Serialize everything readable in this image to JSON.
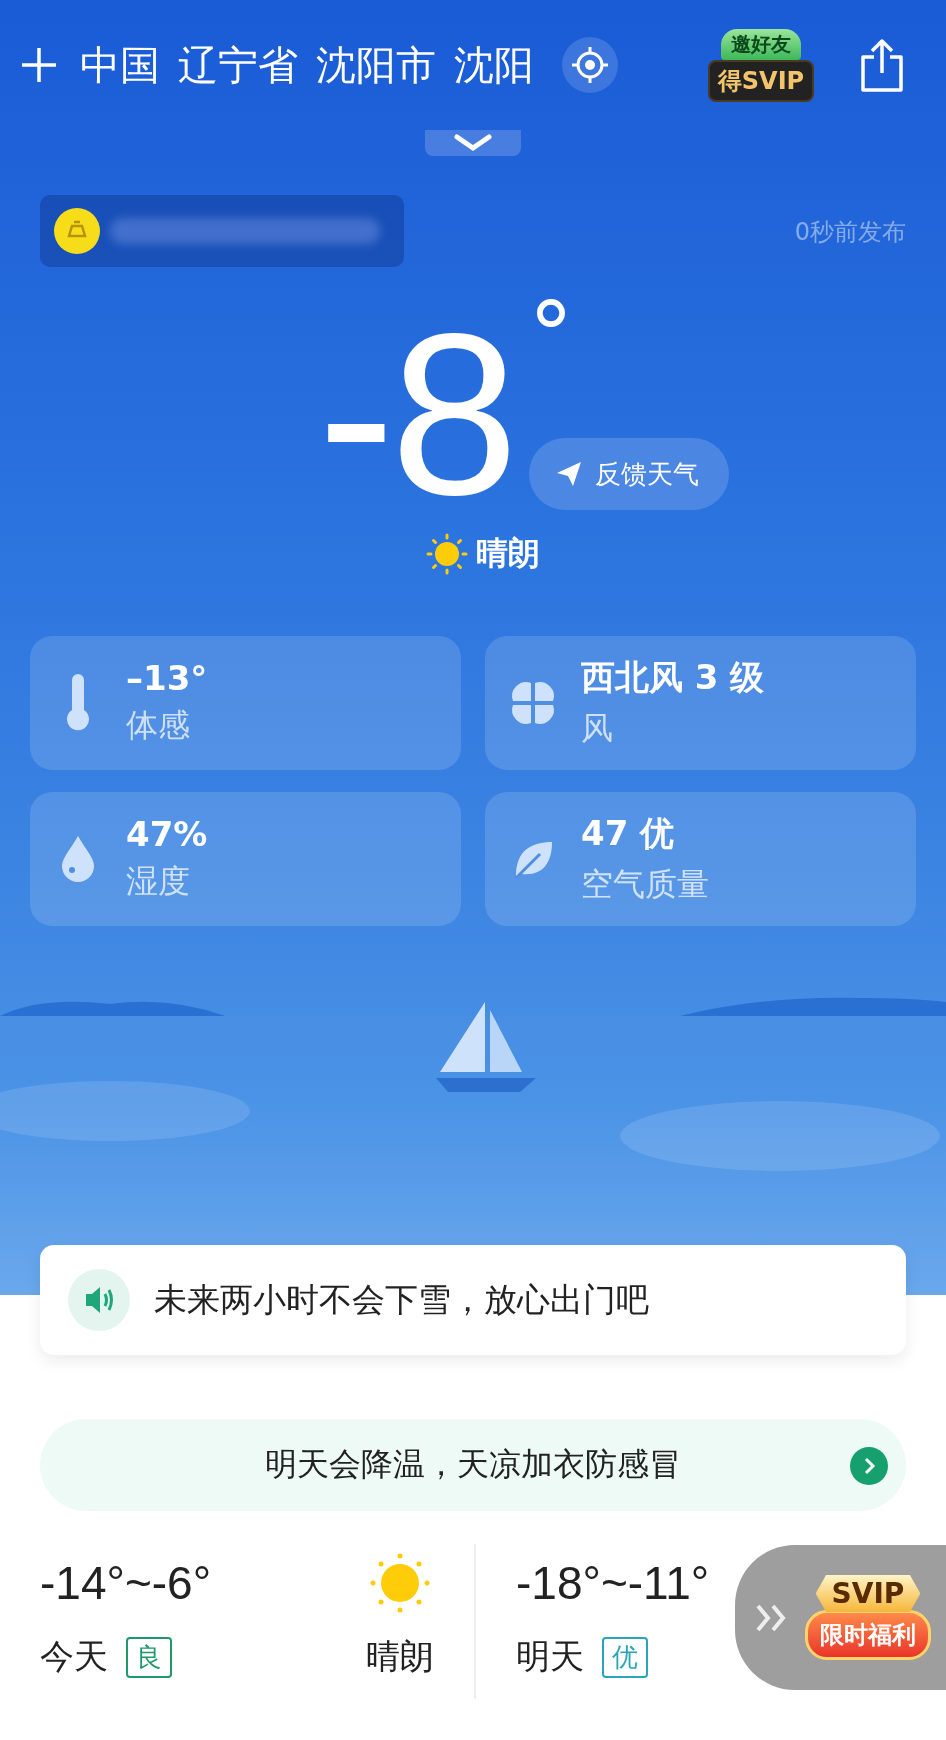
{
  "header": {
    "location": [
      "中国",
      "辽宁省",
      "沈阳市",
      "沈阳"
    ],
    "invite_badge": {
      "top": "邀好友",
      "bottom": "得SVIP"
    }
  },
  "alert": {
    "published": "0秒前发布"
  },
  "current": {
    "temperature": "-8",
    "unit": "°",
    "feedback": "反馈天气",
    "condition": "晴朗"
  },
  "details": [
    {
      "kind": "thermometer",
      "value": "–13°",
      "label": "体感"
    },
    {
      "kind": "wind",
      "value": "西北风 3 级",
      "label": "风"
    },
    {
      "kind": "humidity",
      "value": "47%",
      "label": "湿度"
    },
    {
      "kind": "air",
      "value": "47 优",
      "label": "空气质量"
    }
  ],
  "notice": "未来两小时不会下雪，放心出门吧",
  "tip": "明天会降温，天凉加衣防感冒",
  "forecast": [
    {
      "range": "-14°~-6°",
      "day": "今天",
      "aqi": "良",
      "color": "#1e9a6a",
      "condition": "晴朗"
    },
    {
      "range": "-18°~-11°",
      "day": "明天",
      "aqi": "优",
      "color": "#2aa5b8"
    }
  ],
  "promo": {
    "top": "SVIP",
    "bottom": "限时福利"
  }
}
